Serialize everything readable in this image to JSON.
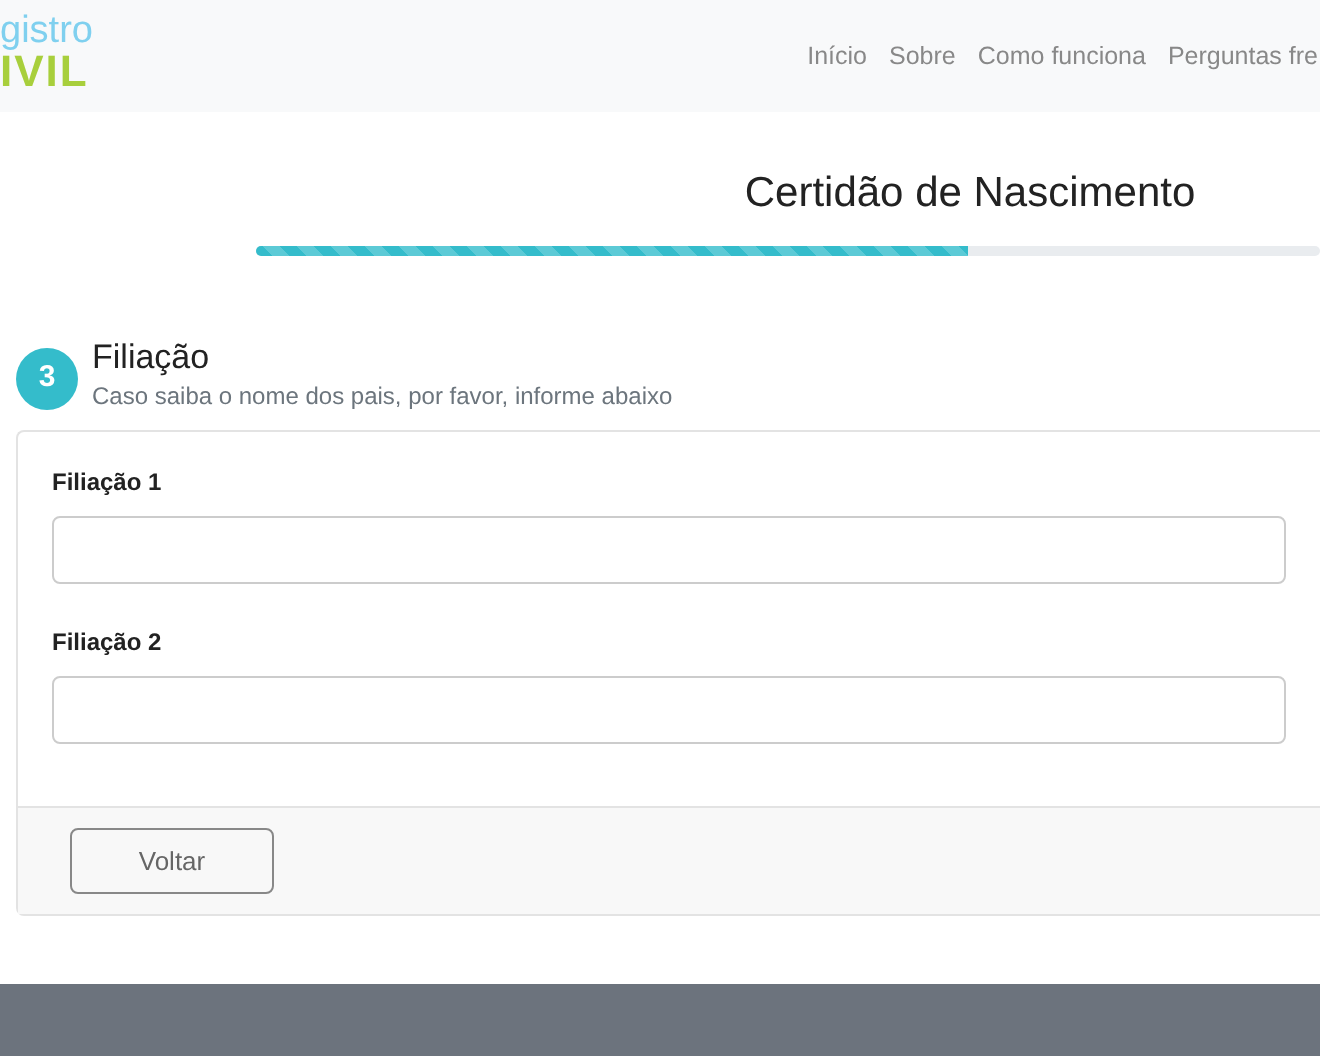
{
  "logo": {
    "line_1": "gistro",
    "line_2": "IVIL"
  },
  "nav": [
    {
      "label": "Início"
    },
    {
      "label": "Sobre"
    },
    {
      "label": "Como funciona"
    },
    {
      "label": "Perguntas fre"
    }
  ],
  "title": "Certidão de Nascimento",
  "progress": {
    "level": 0.67
  },
  "step": {
    "number": "3",
    "title": "Filiação",
    "subtitle": "Caso saiba o nome dos pais, por favor, informe abaixo"
  },
  "fields": [
    {
      "label": "Filiação 1"
    },
    {
      "label": "Filiação 2"
    }
  ],
  "buttons": [
    {
      "label": "Voltar"
    }
  ]
}
